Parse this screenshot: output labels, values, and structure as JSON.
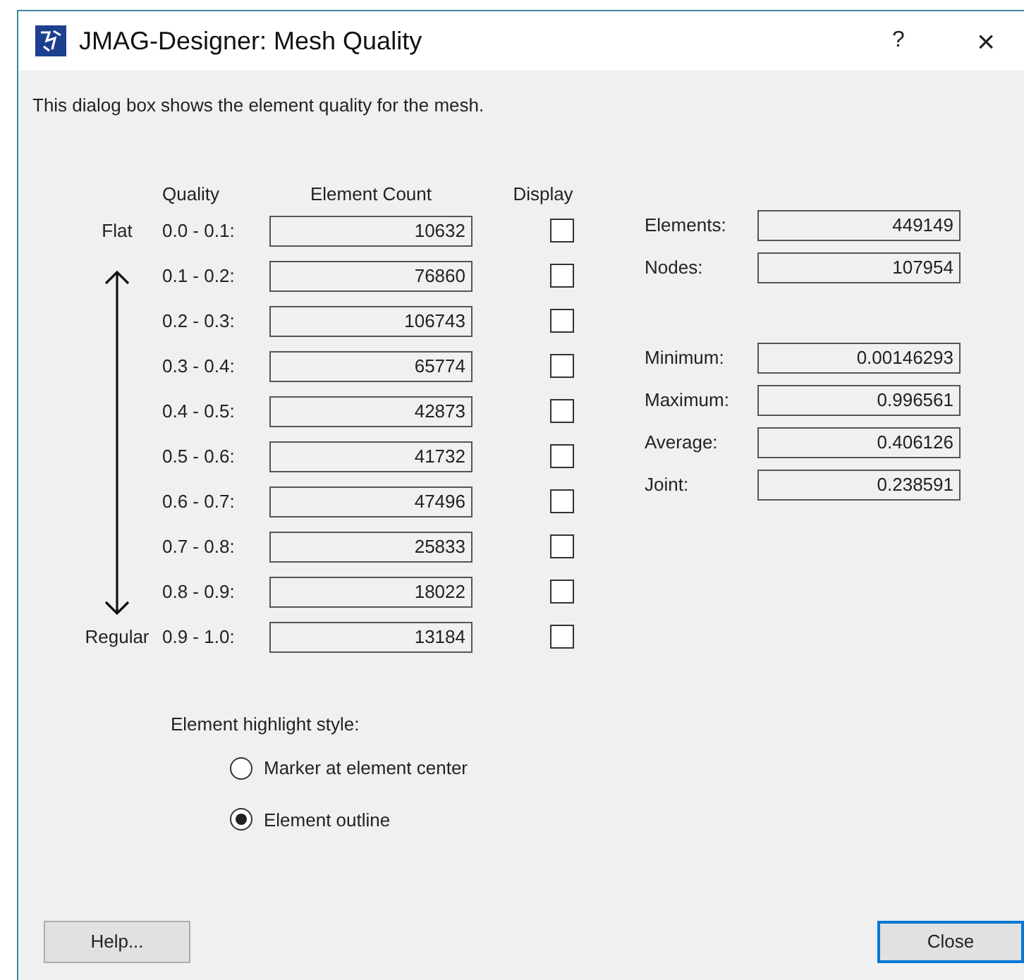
{
  "window": {
    "title": "JMAG-Designer: Mesh Quality",
    "help_glyph": "?",
    "close_glyph": "×"
  },
  "description": "This dialog box shows the element quality for the mesh.",
  "table": {
    "headers": [
      "Quality",
      "Element Count",
      "Display"
    ],
    "rows": [
      {
        "side_label": "Flat",
        "range": "0.0 - 0.1:",
        "count": "10632",
        "display": false
      },
      {
        "range": "0.1 - 0.2:",
        "count": "76860",
        "display": false
      },
      {
        "range": "0.2 - 0.3:",
        "count": "106743",
        "display": false
      },
      {
        "range": "0.3 - 0.4:",
        "count": "65774",
        "display": false
      },
      {
        "range": "0.4 - 0.5:",
        "count": "42873",
        "display": false
      },
      {
        "range": "0.5 - 0.6:",
        "count": "41732",
        "display": false
      },
      {
        "range": "0.6 - 0.7:",
        "count": "47496",
        "display": false
      },
      {
        "range": "0.7 - 0.8:",
        "count": "25833",
        "display": false
      },
      {
        "range": "0.8 - 0.9:",
        "count": "18022",
        "display": false
      },
      {
        "side_label": "Regular",
        "range": "0.9 - 1.0:",
        "count": "13184",
        "display": false
      }
    ]
  },
  "stats": [
    [
      {
        "label": "Elements:",
        "value": "449149"
      },
      {
        "label": "Nodes:",
        "value": "107954"
      }
    ],
    [
      {
        "label": "Minimum:",
        "value": "0.00146293"
      },
      {
        "label": "Maximum:",
        "value": "0.996561"
      },
      {
        "label": "Average:",
        "value": "0.406126"
      },
      {
        "label": "Joint:",
        "value": "0.238591"
      }
    ]
  ],
  "highlight": {
    "label": "Element highlight style:",
    "options": [
      {
        "label": "Marker at element center",
        "selected": false
      },
      {
        "label": "Element outline",
        "selected": true
      }
    ]
  },
  "buttons": [
    {
      "label": "Help...",
      "focused": false
    },
    {
      "label": "Close",
      "focused": true
    }
  ]
}
